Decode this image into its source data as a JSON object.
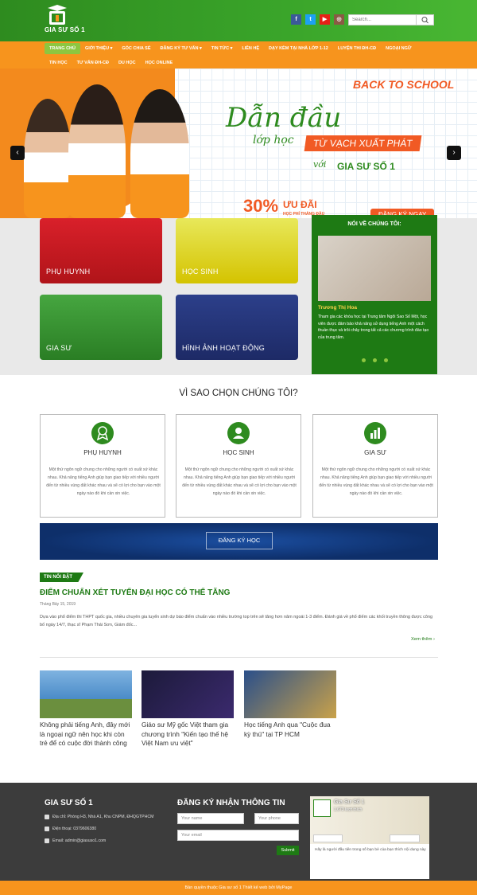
{
  "header": {
    "logo_text": "GIA SƯ SỐ 1",
    "social": [
      {
        "name": "facebook-icon",
        "glyph": "f",
        "color": "#3b5998"
      },
      {
        "name": "twitter-icon",
        "glyph": "t",
        "color": "#1da1f2"
      },
      {
        "name": "youtube-icon",
        "glyph": "▶",
        "color": "#e62117"
      },
      {
        "name": "instagram-icon",
        "glyph": "◎",
        "color": "#8a5a44"
      }
    ],
    "search_placeholder": "Search..."
  },
  "nav": {
    "row1": [
      "TRANG CHỦ",
      "GIỚI THIỆU ▾",
      "GÓC CHIA SẺ",
      "ĐĂNG KÝ TƯ VẤN ▾",
      "TIN TỨC ▾",
      "LIÊN HỆ",
      "DẠY KÈM TẠI NHÀ LỚP 1-12",
      "LUYỆN THI ĐH-CĐ",
      "NGOẠI NGỮ"
    ],
    "row2": [
      "TIN HỌC",
      "TƯ VẤN ĐH-CĐ",
      "DU HỌC",
      "HỌC ONLINE"
    ]
  },
  "hero": {
    "back_to_school": "BACK TO SCHOOL",
    "headline": "Dẫn đầu",
    "subline": "lớp học",
    "start": "TỪ VẠCH XUẤT PHÁT",
    "with": "với",
    "brand": "GIA SƯ SỐ 1",
    "percent": "30%",
    "offer": "ƯU ĐÃI",
    "offer_sub": "HỌC PHÍ THÁNG ĐẦU",
    "register": "ĐĂNG KÝ NGAY",
    "prev": "‹",
    "next": "›"
  },
  "cards": [
    "PHỤ HUYNH",
    "HỌC SINH",
    "GIA SƯ",
    "HÌNH ẢNH HOẠT ĐỘNG"
  ],
  "about": {
    "title": "NÓI VỀ CHÚNG TÔI:",
    "name": "Trương Thị Hoa",
    "desc": "Tham gia các khóa học tại Trung tâm Ngôi Sao Số Một, học viên được đảm bảo khả năng sử dụng tiếng Anh một cách thuần thục và trôi chảy trong tất cả các chương trình đào tạo của trung tâm."
  },
  "why": {
    "title": "VÌ SAO CHỌN CHÚNG TÔI?",
    "boxes": [
      {
        "title": "PHỤ HUYNH",
        "body": "Một thứ ngôn ngữ chung cho những người có xuất xứ khác nhau. Khả năng tiếng Anh giúp bạn giao tiếp với nhiều người đến từ nhiều vùng đất khác nhau và sẽ có lợi cho bạn vào một ngày nào đó khi cần xin việc."
      },
      {
        "title": "HỌC SINH",
        "body": "Một thứ ngôn ngữ chung cho những người có xuất xứ khác nhau. Khả năng tiếng Anh giúp bạn giao tiếp với nhiều người đến từ nhiều vùng đất khác nhau và sẽ có lợi cho bạn vào một ngày nào đó khi cần xin việc."
      },
      {
        "title": "GIA SƯ",
        "body": "Một thứ ngôn ngữ chung cho những người có xuất xứ khác nhau. Khả năng tiếng Anh giúp bạn giao tiếp với nhiều người đến từ nhiều vùng đất khác nhau và sẽ có lợi cho bạn vào một ngày nào đó khi cần xin việc."
      }
    ]
  },
  "banner_button": "ĐĂNG KÝ HỌC",
  "news": {
    "tag": "TIN NỔI BẬT",
    "title": "ĐIỂM CHUẨN XÉT TUYỂN ĐẠI HỌC CÓ THỂ TĂNG",
    "date": "Tháng Bảy 15, 2019",
    "body": "Dựa vào phổ điểm thi THPT quốc gia, nhiều chuyên gia tuyển sinh dự báo điểm chuẩn vào nhiều trường top trên sẽ tăng hơn năm ngoái 1-3 điểm. Đánh giá về phổ điểm các khối truyền thông được công bố ngày 14/7, thạc sĩ Phạm Thái Sơn, Giám đốc...",
    "more": "Xem thêm ›"
  },
  "articles": [
    {
      "title": "Không phải tiếng Anh, đây mới là ngoại ngữ nên học khi còn trẻ để có cuộc đời thành công"
    },
    {
      "title": "Giáo sư Mỹ gốc Việt tham gia chương trình \"Kiến tạo thế hệ Việt Nam ưu việt\""
    },
    {
      "title": "Học tiếng Anh qua \"Cuộc đua kỳ thú\" tại TP HCM"
    }
  ],
  "footer": {
    "brand": "GIA SƯ SỐ 1",
    "address": "Địa chỉ: Phòng H3, Nhà A1, Khu CNPM, ĐHQGTPHCM",
    "phone": "Điện thoại: 0379606380",
    "email": "Email: admin@giasuso1.com",
    "form_title": "ĐĂNG KÝ NHẬN THÔNG TIN",
    "name_ph": "Your name",
    "phone_ph": "Your phone",
    "email_ph": "Your email",
    "submit": "Submit",
    "fb_name": "Gia Sư Số 1",
    "fb_likes": "1.673 lượt thích",
    "fb_like_btn": "Thích Trang",
    "fb_msg_btn": "Gửi tin nhắn",
    "fb_note": "Hãy là người đầu tiên trong số bạn bè của bạn thích nội dung này"
  },
  "copyright": "Bản quyền thuộc Gia sư số 1 Thiết kế web bởi MyPage"
}
